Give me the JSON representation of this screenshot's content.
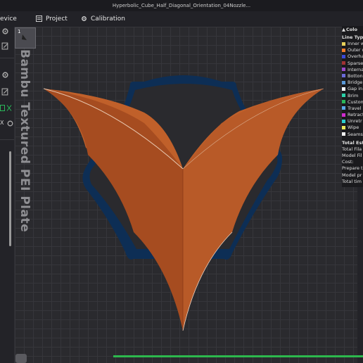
{
  "window": {
    "title": "Hyperbolic_Cube_Half_Diagonal_Orientation_04Nozzle..."
  },
  "tabs": [
    {
      "label": "evice"
    },
    {
      "label": "Project"
    },
    {
      "label": "Calibration"
    }
  ],
  "left_panel": {
    "x_label": "X"
  },
  "plate": {
    "label": "Bambu Textured PEI Plate",
    "thumb_number": "1"
  },
  "legend": {
    "title": "Colo",
    "section": "Line Typ",
    "items": [
      {
        "label": "Inner w",
        "color": "#e8d15a"
      },
      {
        "label": "Outer w",
        "color": "#f07b2a"
      },
      {
        "label": "Overha",
        "color": "#3a4ad8"
      },
      {
        "label": "Sparse",
        "color": "#a03232"
      },
      {
        "label": "Interna",
        "color": "#9a4ac8"
      },
      {
        "label": "Botton",
        "color": "#6a6ad8"
      },
      {
        "label": "Bridge",
        "color": "#5c9ad8"
      },
      {
        "label": "Gap in",
        "color": "#ffffff"
      },
      {
        "label": "Brim",
        "color": "#2ad0a8"
      },
      {
        "label": "Custom",
        "color": "#2ab85a"
      },
      {
        "label": "Travel",
        "color": "#5aa8e8"
      },
      {
        "label": "Retract",
        "color": "#d02ad0"
      },
      {
        "label": "Unretr",
        "color": "#2ad0d0"
      },
      {
        "label": "Wipe",
        "color": "#e8e85a"
      },
      {
        "label": "Seams",
        "color": "#f0f0f0"
      }
    ],
    "summary_title": "Total Est",
    "summary": [
      "Total Fila",
      "Model Fil",
      "Cost:",
      "Prepare t",
      "Model pr",
      "Total tim"
    ]
  },
  "colors": {
    "model": "#c0602a",
    "brim": "#0d2e55",
    "progress": "#2db84d"
  }
}
